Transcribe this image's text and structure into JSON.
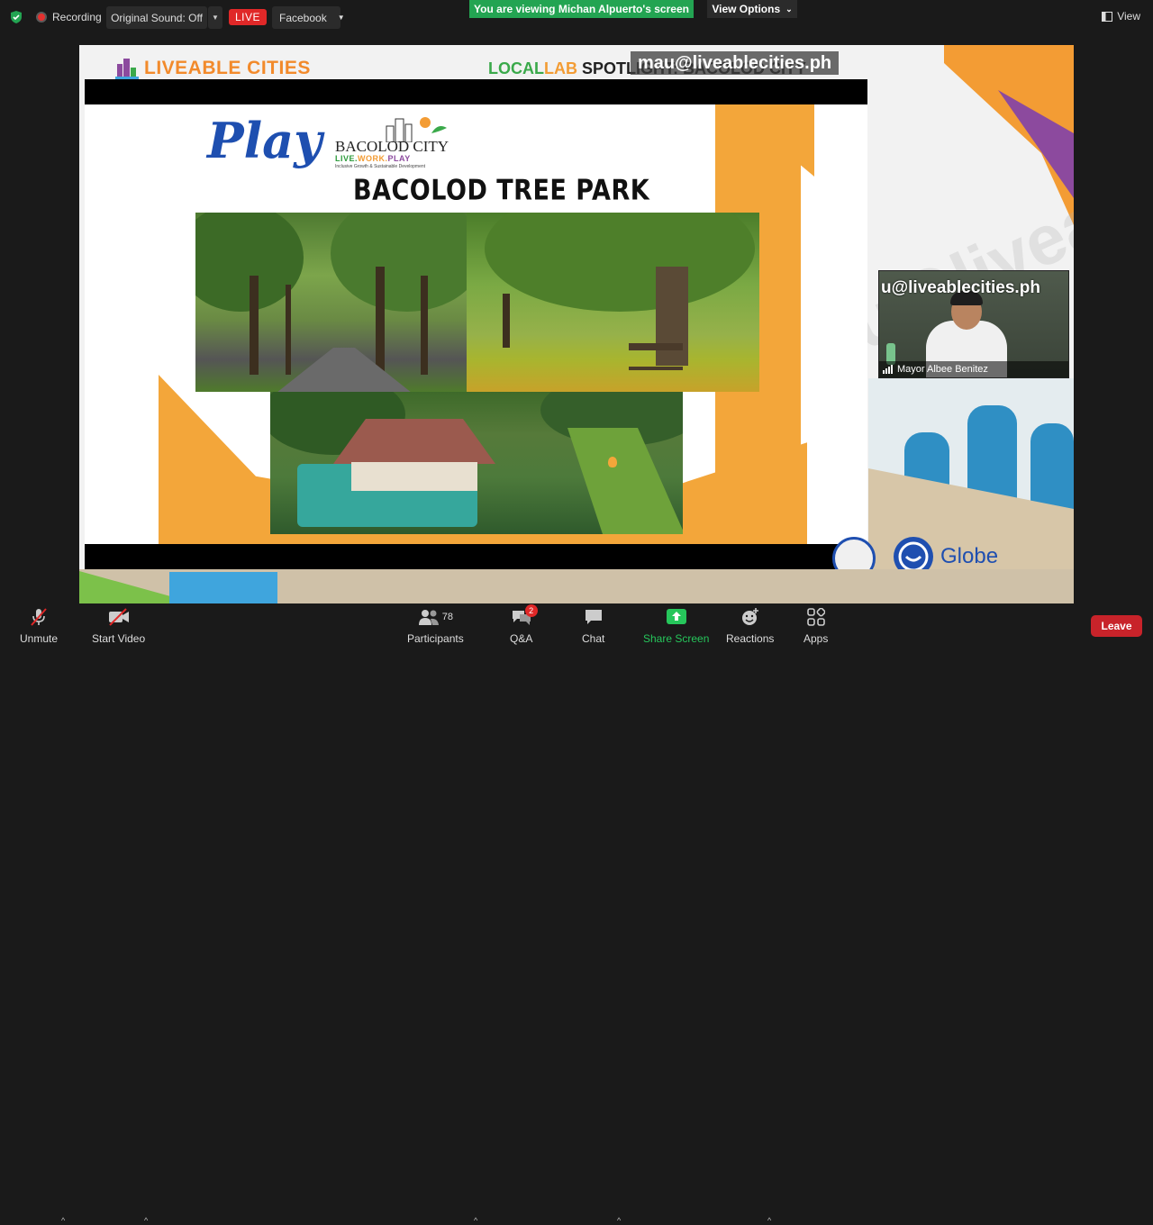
{
  "topbar": {
    "recording_label": "Recording",
    "original_sound_label": "Original Sound: Off",
    "live_label": "LIVE",
    "facebook_label": "Facebook",
    "viewing_banner": "You are viewing Michan Alpuerto's screen",
    "view_options_label": "View Options",
    "view_label": "View"
  },
  "shared_screen": {
    "header": {
      "logo_text": "LIVEABLE CITIES",
      "locallab_a": "LOCAL",
      "locallab_b": "LAB",
      "locallab_c": " SPOTLIGHT: BACOLOD CITY",
      "watermark": "mau@liveablecities.ph"
    },
    "slide": {
      "play_text": "Play",
      "city_name": "BACOLOD CITY",
      "lwp_live": "LIVE.",
      "lwp_work": "WORK.",
      "lwp_play": "PLAY",
      "tagline": "Inclusive Growth & Sustainable Development",
      "title": "BACOLOD TREE PARK"
    },
    "diag_watermark": "mau@liveablecities.ph",
    "video_tile": {
      "watermark": "u@liveablecities.ph",
      "name": "Mayor Albee Benitez"
    },
    "sponsor_text": "Globe"
  },
  "toolbar": {
    "unmute_label": "Unmute",
    "start_video_label": "Start Video",
    "participants_label": "Participants",
    "participants_count": "78",
    "qa_label": "Q&A",
    "qa_badge": "2",
    "chat_label": "Chat",
    "share_screen_label": "Share Screen",
    "reactions_label": "Reactions",
    "apps_label": "Apps",
    "leave_label": "Leave"
  },
  "colors": {
    "zoom_green": "#23a452",
    "live_red": "#e02828",
    "leave_red": "#c8232a",
    "share_green": "#26c65b",
    "slide_orange": "#f3a63a",
    "play_blue": "#1e4fb0"
  }
}
